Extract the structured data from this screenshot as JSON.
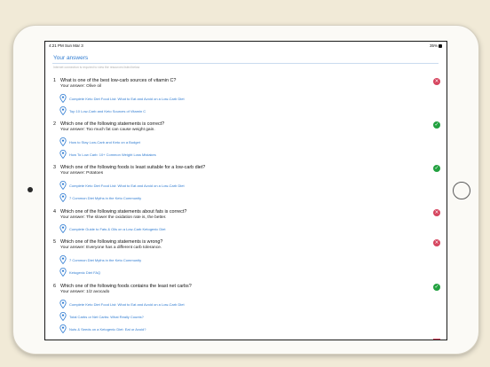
{
  "status_bar": {
    "time": "4:21 PM   Sun Mar 3",
    "battery": "35%"
  },
  "header": {
    "title": "Your answers",
    "notice": "Internet connection is required to view the resources listed below"
  },
  "questions": [
    {
      "num": "1",
      "text": "What is one of the best low-carb sources of vitamin C?",
      "answer": "Your answer: Olive oil",
      "result": "wrong",
      "links": [
        "Complete Keto Diet Food List: What to Eat and Avoid on a Low-Carb Diet",
        "Top 10 Low-Carb and Keto Sources of Vitamin C"
      ]
    },
    {
      "num": "2",
      "text": "Which one of the following statements is correct?",
      "answer": "Your answer: Too much fat can cause weight gain.",
      "result": "correct",
      "links": [
        "How to Stay Low-Carb and Keto on a Budget",
        "How To Low Carb: 10+ Common Weight Loss Mistakes"
      ]
    },
    {
      "num": "3",
      "text": "Which one of the following foods is least suitable for a low-carb diet?",
      "answer": "Your answer: Potatoes",
      "result": "correct",
      "links": [
        "Complete Keto Diet Food List: What to Eat and Avoid on a Low-Carb Diet",
        "7 Common Diet Myths in the Keto Community"
      ]
    },
    {
      "num": "4",
      "text": "Which one of the following statements about fats is correct?",
      "answer": "Your answer: The slower the oxidation rate is, the better.",
      "result": "wrong",
      "links": [
        "Complete Guide to Fats & Oils on a Low-Carb Ketogenic Diet"
      ]
    },
    {
      "num": "5",
      "text": "Which one of the following statements is wrong?",
      "answer": "Your answer: Everyone has a different carb tolerance.",
      "result": "wrong",
      "links": [
        "7 Common Diet Myths in the Keto Community",
        "Ketogenic Diet FAQ"
      ]
    },
    {
      "num": "6",
      "text": "Which one of the following foods contains the least net carbs?",
      "answer": "Your answer: 1/2 avocado",
      "result": "correct",
      "links": [
        "Complete Keto Diet Food List: What to Eat and Avoid on a Low-Carb Diet",
        "Total Carbs or Net Carbs: What Really Counts?",
        "Nuts & Seeds on a Ketogenic Diet: Eat or Avoid?"
      ]
    }
  ],
  "colors": {
    "accent": "#2e7bd1",
    "wrong": "#d6455f",
    "correct": "#22a140"
  },
  "icons": {
    "wrong": "x-circle-icon",
    "correct": "check-circle-icon",
    "link": "location-pin-icon"
  }
}
